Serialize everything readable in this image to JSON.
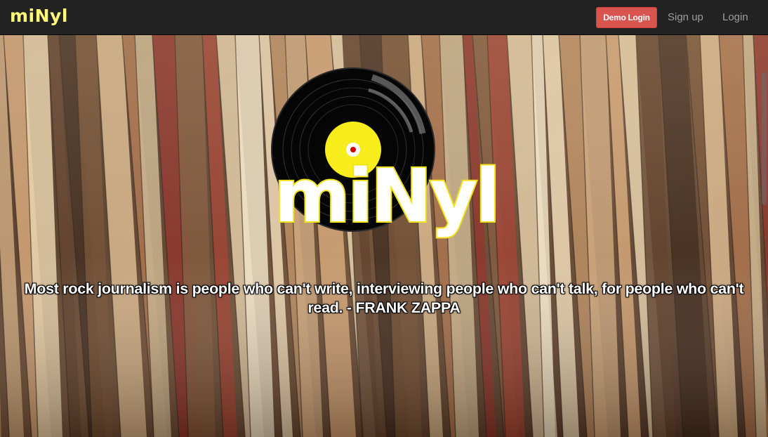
{
  "navbar": {
    "brand": "miNyl",
    "demo_login_label": "Demo Login",
    "signup_label": "Sign up",
    "login_label": "Login",
    "demo_button_color": "#d9534f",
    "brand_color": "#fff97a"
  },
  "hero": {
    "logo_text": "miNyl",
    "logo_icon": "vinyl-record-icon",
    "quote": "Most rock journalism is people who can't write, interviewing people who can't talk, for people who can't read. - FRANK ZAPPA"
  }
}
